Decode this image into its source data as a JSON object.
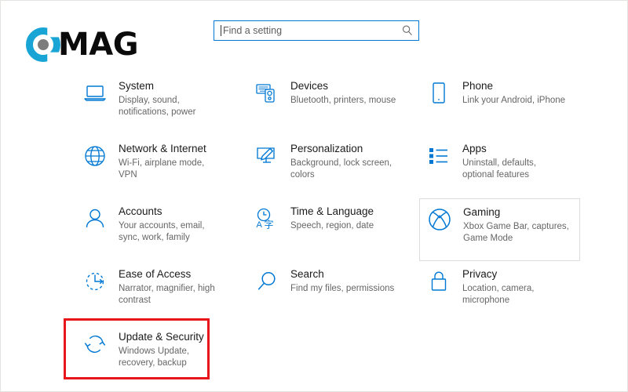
{
  "brand": {
    "logo_text": "MAG",
    "logo_mark_name": "c-circle-logo",
    "accent_color": "#18a5d6",
    "dot_color": "#7d7d7d"
  },
  "search": {
    "placeholder": "Find a setting",
    "value": "",
    "icon": "search-icon"
  },
  "theme": {
    "icon_color": "#0078d4",
    "title_color": "#1b1b1b",
    "subtitle_color": "#666666",
    "annotation_color": "#e8161b",
    "search_border_color": "#0078d4"
  },
  "annotation": {
    "shape": "rectangle",
    "target": "Update & Security",
    "color": "#e8161b"
  },
  "settings": {
    "rows": [
      [
        {
          "title": "System",
          "subtitle": "Display, sound, notifications, power",
          "icon": "laptop-icon",
          "highlighted": false
        },
        {
          "title": "Devices",
          "subtitle": "Bluetooth, printers, mouse",
          "icon": "devices-icon",
          "highlighted": false
        },
        {
          "title": "Phone",
          "subtitle": "Link your Android, iPhone",
          "icon": "phone-icon",
          "highlighted": false
        }
      ],
      [
        {
          "title": "Network & Internet",
          "subtitle": "Wi-Fi, airplane mode, VPN",
          "icon": "globe-icon",
          "highlighted": false
        },
        {
          "title": "Personalization",
          "subtitle": "Background, lock screen, colors",
          "icon": "personalization-brush-icon",
          "highlighted": false
        },
        {
          "title": "Apps",
          "subtitle": "Uninstall, defaults, optional features",
          "icon": "apps-list-icon",
          "highlighted": false
        }
      ],
      [
        {
          "title": "Accounts",
          "subtitle": "Your accounts, email, sync, work, family",
          "icon": "person-icon",
          "highlighted": false
        },
        {
          "title": "Time & Language",
          "subtitle": "Speech, region, date",
          "icon": "clock-language-icon",
          "highlighted": false
        },
        {
          "title": "Gaming",
          "subtitle": "Xbox Game Bar, captures, Game Mode",
          "icon": "xbox-icon",
          "highlighted": true
        }
      ],
      [
        {
          "title": "Ease of Access",
          "subtitle": "Narrator, magnifier, high contrast",
          "icon": "ease-of-access-icon",
          "highlighted": false
        },
        {
          "title": "Search",
          "subtitle": "Find my files, permissions",
          "icon": "magnifier-icon",
          "highlighted": false
        },
        {
          "title": "Privacy",
          "subtitle": "Location, camera, microphone",
          "icon": "lock-icon",
          "highlighted": false
        }
      ],
      [
        {
          "title": "Update & Security",
          "subtitle": "Windows Update, recovery, backup",
          "icon": "refresh-sync-icon",
          "highlighted": false,
          "annotated": true
        }
      ]
    ]
  }
}
